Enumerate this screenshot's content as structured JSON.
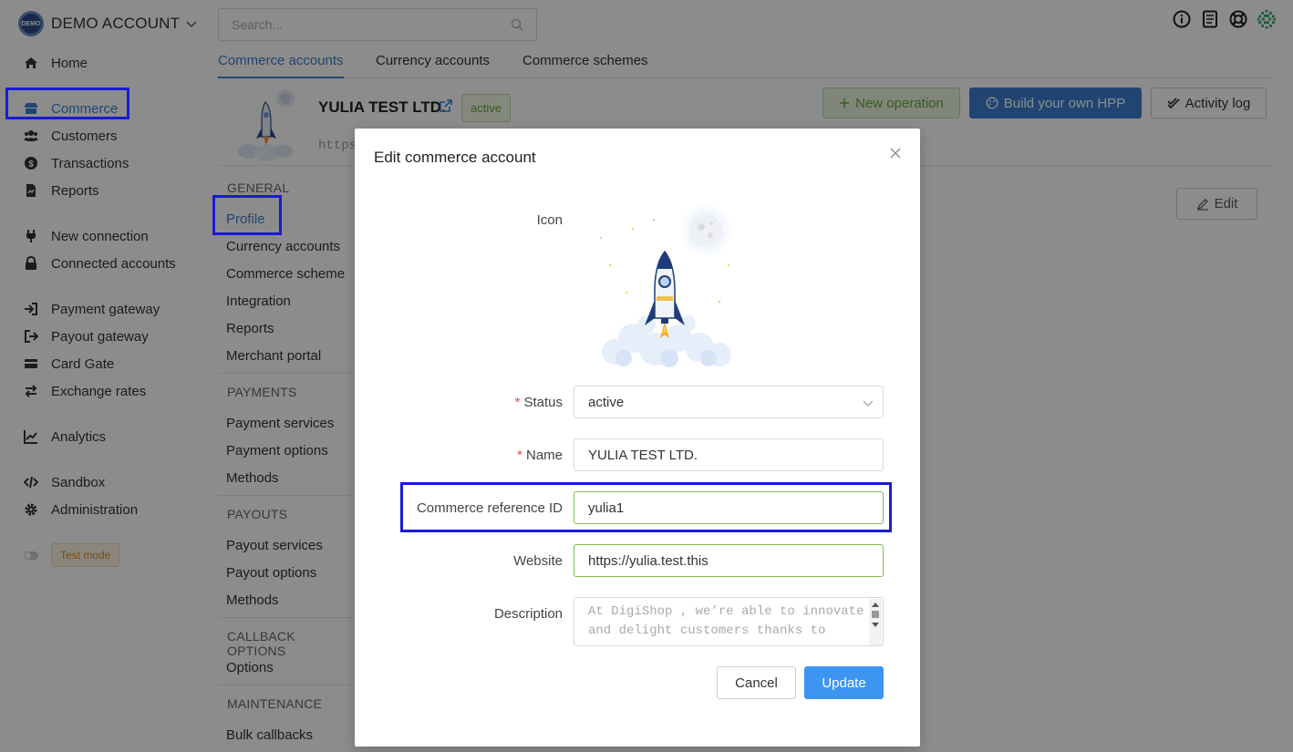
{
  "sidebar": {
    "brand": {
      "logo_text": "DEMO",
      "name": "DEMO ACCOUNT"
    },
    "items": [
      {
        "label": "Home",
        "icon": "home-icon"
      },
      {
        "label": "Commerce",
        "icon": "store-icon",
        "active": true
      },
      {
        "label": "Customers",
        "icon": "users-icon"
      },
      {
        "label": "Transactions",
        "icon": "dollar-icon"
      },
      {
        "label": "Reports",
        "icon": "report-icon"
      },
      {
        "label": "New connection",
        "icon": "plug-icon"
      },
      {
        "label": "Connected accounts",
        "icon": "lock-icon"
      },
      {
        "label": "Payment gateway",
        "icon": "sign-in-icon"
      },
      {
        "label": "Payout gateway",
        "icon": "sign-out-icon"
      },
      {
        "label": "Card Gate",
        "icon": "credit-card-icon"
      },
      {
        "label": "Exchange rates",
        "icon": "exchange-icon"
      },
      {
        "label": "Analytics",
        "icon": "chart-line-icon"
      },
      {
        "label": "Sandbox",
        "icon": "code-icon"
      },
      {
        "label": "Administration",
        "icon": "gear-icon"
      }
    ],
    "test_mode": "Test mode"
  },
  "search": {
    "placeholder": "Search..."
  },
  "tabs": [
    "Commerce accounts",
    "Currency accounts",
    "Commerce schemes"
  ],
  "account": {
    "title": "YULIA TEST LTD.",
    "status": "active",
    "url_fragment": "https"
  },
  "actions": {
    "new_operation": "New operation",
    "build_hpp": "Build your own HPP",
    "activity_log": "Activity log",
    "edit": "Edit"
  },
  "settings_menu": {
    "general": "GENERAL",
    "general_items": [
      "Profile",
      "Currency accounts",
      "Commerce scheme",
      "Integration",
      "Reports",
      "Merchant portal"
    ],
    "payments": "PAYMENTS",
    "payments_items": [
      "Payment services",
      "Payment options",
      "Methods"
    ],
    "payouts": "PAYOUTS",
    "payouts_items": [
      "Payout services",
      "Payout options",
      "Methods"
    ],
    "callback": "CALLBACK OPTIONS",
    "callback_items": [
      "Options"
    ],
    "maintenance": "MAINTENANCE",
    "maintenance_items": [
      "Bulk callbacks"
    ]
  },
  "modal": {
    "title": "Edit commerce account",
    "icon_label": "Icon",
    "status_label": "Status",
    "status_value": "active",
    "name_label": "Name",
    "name_value": "YULIA TEST LTD.",
    "ref_label": "Commerce reference ID",
    "ref_value": "yulia1",
    "website_label": "Website",
    "website_value": "https://yulia.test.this",
    "description_label": "Description",
    "description_value": "At DigiShop , we’re able to innovate and delight customers thanks to",
    "cancel": "Cancel",
    "update": "Update"
  },
  "colors": {
    "accent": "#3c7ecf",
    "primary_button": "#3d95f2",
    "success": "#6aa73b",
    "highlight": "#1a1ad6",
    "required": "#e04a4a"
  }
}
